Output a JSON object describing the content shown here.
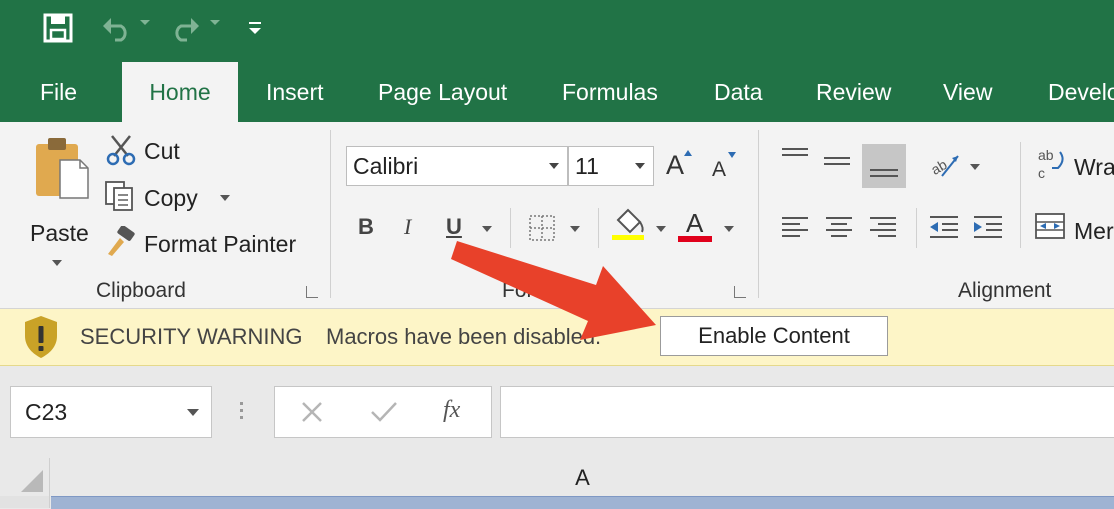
{
  "qat": {
    "save": "save-icon",
    "undo": "undo-icon",
    "redo": "redo-icon",
    "customize": "customize-qat-icon"
  },
  "tabs": [
    {
      "label": "File"
    },
    {
      "label": "Home"
    },
    {
      "label": "Insert"
    },
    {
      "label": "Page Layout"
    },
    {
      "label": "Formulas"
    },
    {
      "label": "Data"
    },
    {
      "label": "Review"
    },
    {
      "label": "View"
    },
    {
      "label": "Develo"
    }
  ],
  "clipboard": {
    "paste_label": "Paste",
    "cut_label": "Cut",
    "copy_label": "Copy",
    "format_painter_label": "Format Painter",
    "group_label": "Clipboard"
  },
  "font": {
    "font_name": "Calibri",
    "font_size": "11",
    "bold_label": "B",
    "italic_label": "I",
    "underline_label": "U",
    "font_color_label": "A",
    "grow_label": "A",
    "shrink_label": "A",
    "group_label": "Font",
    "fill_color": "#ffff00",
    "text_color": "#e0001b"
  },
  "alignment": {
    "wrap_text_label": "Wra",
    "merge_label": "Mer",
    "group_label": "Alignment"
  },
  "security": {
    "title": "SECURITY WARNING",
    "message": "Macros have been disabled.",
    "button_label": "Enable Content"
  },
  "formula_bar": {
    "name_box": "C23",
    "fx_label": "fx",
    "formula": ""
  },
  "grid": {
    "column_header": "A"
  },
  "colors": {
    "brand": "#217346",
    "warning_bar": "#fdf5c7",
    "arrow": "#e8412a"
  }
}
